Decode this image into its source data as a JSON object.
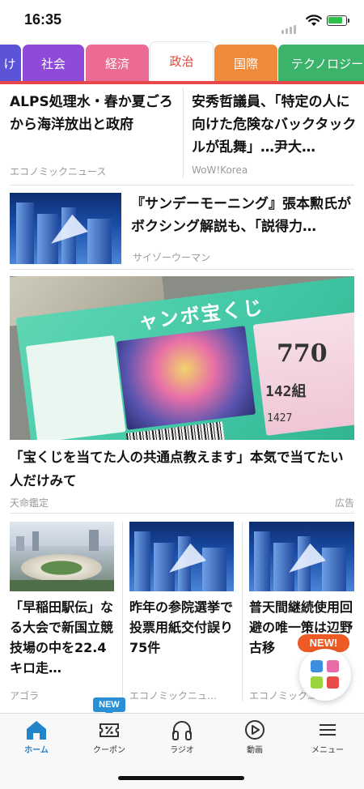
{
  "status_bar": {
    "time": "16:35",
    "battery_level": 0.85
  },
  "tabs": [
    {
      "label": "け",
      "color": "#5b54d6"
    },
    {
      "label": "社会",
      "color": "#8f4ad8"
    },
    {
      "label": "経済",
      "color": "#ec6b93"
    },
    {
      "label": "政治",
      "color": "#ffffff",
      "active": true
    },
    {
      "label": "国際",
      "color": "#ee8a3a"
    },
    {
      "label": "テクノロジー",
      "color": "#3bb36a"
    }
  ],
  "top_articles": [
    {
      "title": "ALPS処理水・春か夏ごろから海洋放出と政府",
      "source": "エコノミックニュース"
    },
    {
      "title": "安秀哲議員、「特定の人に向けた危険なバックタックルが乱舞」…尹大…",
      "source": "WoW!Korea"
    }
  ],
  "list_article": {
    "title": "『サンデーモーニング』張本勲氏がボクシング解説も、「説得力…",
    "source": "サイゾーウーマン"
  },
  "ad": {
    "title": "「宝くじを当てた人の共通点教えます」本気で当てたい人だけみて",
    "source": "天命鑑定",
    "label": "広告",
    "ticket_title": "ャンボ宝くじ",
    "ticket_number": "770",
    "ticket_group": "142組",
    "ticket_serial": "1427"
  },
  "grid_articles": [
    {
      "title": "「早稲田駅伝」なる大会で新国立競技場の中を22.4キロ走…",
      "source": "アゴラ"
    },
    {
      "title": "昨年の参院選挙で投票用紙交付誤り75件",
      "source": "エコノミックニュ…"
    },
    {
      "title": "普天間継続使用回避の唯一策は辺野古移",
      "source": "エコノミックニュ…"
    }
  ],
  "fab": {
    "badge": "NEW!"
  },
  "nav": {
    "items": [
      {
        "label": "ホーム",
        "icon": "home-icon",
        "active": true
      },
      {
        "label": "クーポン",
        "icon": "coupon-icon"
      },
      {
        "label": "ラジオ",
        "icon": "headphones-icon"
      },
      {
        "label": "動画",
        "icon": "play-icon"
      },
      {
        "label": "メニュー",
        "icon": "menu-icon"
      }
    ],
    "coupon_badge": "NEW"
  },
  "colors": {
    "accent_red": "#e7464a",
    "nav_active": "#2385c9",
    "badge_orange": "#ee5a24"
  }
}
